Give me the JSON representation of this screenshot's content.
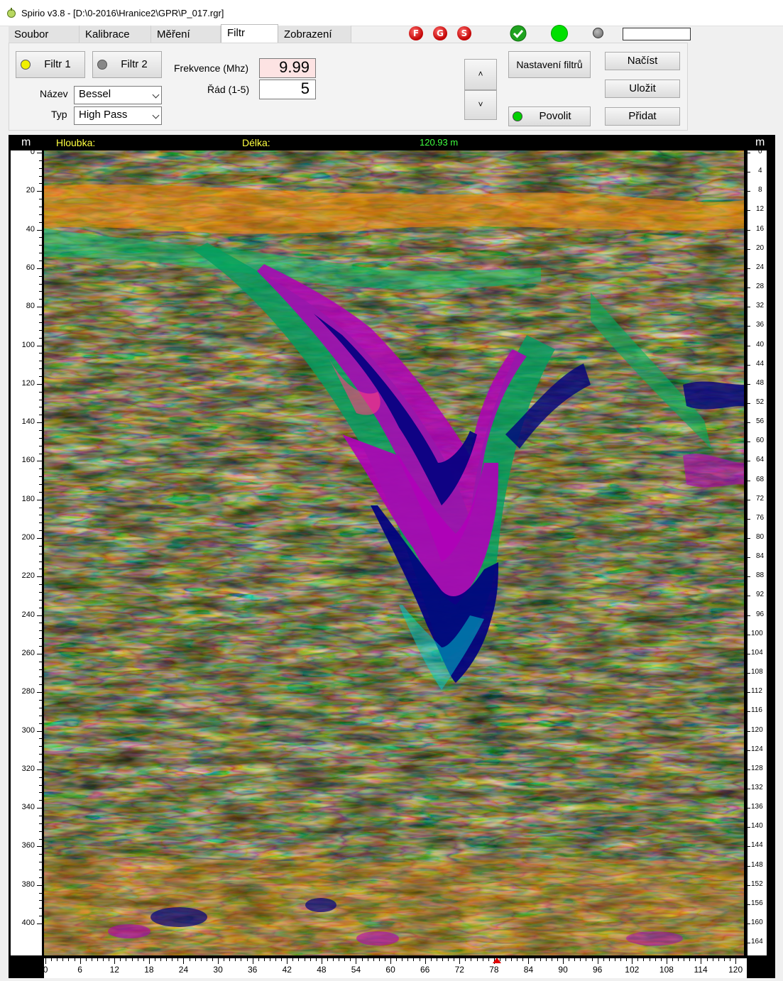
{
  "window": {
    "title": "Spirio v3.8 - [D:\\0-2016\\Hranice2\\GPR\\P_017.rgr]"
  },
  "menu": {
    "tabs": [
      {
        "label": "Soubor"
      },
      {
        "label": "Kalibrace"
      },
      {
        "label": "Měření"
      },
      {
        "label": "Filtr"
      },
      {
        "label": "Zobrazení"
      }
    ]
  },
  "toolbar": {
    "f_label": "F",
    "g_label": "G",
    "s_label": "S"
  },
  "filter_panel": {
    "filtr1_label": "Filtr 1",
    "filtr2_label": "Filtr 2",
    "nazev_label": "Název",
    "nazev_value": "Bessel",
    "typ_label": "Typ",
    "typ_value": "High Pass",
    "freq_label": "Frekvence (Mhz)",
    "freq_value": "9.99",
    "rad_label": "Řád (1-5)",
    "rad_value": "5",
    "up_label": "˄",
    "down_label": "˅",
    "nastaveni_label": "Nastavení filtrů",
    "povolit_label": "Povolit",
    "nacist_label": "Načíst",
    "ulozit_label": "Uložit",
    "pridat_label": "Přidat"
  },
  "radargram": {
    "hloubka_label": "Hloubka:",
    "delka_label": "Délka:",
    "length_value": "120.93 m",
    "left_unit": "m",
    "right_unit": "m",
    "left_ticks": [
      "0",
      "20",
      "40",
      "60",
      "80",
      "100",
      "120",
      "140",
      "160",
      "180",
      "200",
      "220",
      "240",
      "260",
      "280",
      "300",
      "320",
      "340",
      "360",
      "380",
      "400"
    ],
    "right_ticks": [
      "0",
      "4",
      "8",
      "12",
      "16",
      "20",
      "24",
      "28",
      "32",
      "36",
      "40",
      "44",
      "48",
      "52",
      "56",
      "60",
      "64",
      "68",
      "72",
      "76",
      "80",
      "84",
      "88",
      "92",
      "96",
      "100",
      "104",
      "108",
      "112",
      "116",
      "120",
      "124",
      "128",
      "132",
      "136",
      "140",
      "144",
      "148",
      "152",
      "156",
      "160",
      "164"
    ],
    "bottom_ticks": [
      "0",
      "6",
      "12",
      "18",
      "24",
      "30",
      "36",
      "42",
      "48",
      "54",
      "60",
      "66",
      "72",
      "78",
      "84",
      "90",
      "96",
      "102",
      "108",
      "114",
      "120"
    ]
  },
  "colors": {
    "status_ok": "#1fa31f",
    "status_green": "#00e000",
    "status_gray": "#808080",
    "title_yellow": "#ffff40",
    "length_green": "#40ff40"
  }
}
